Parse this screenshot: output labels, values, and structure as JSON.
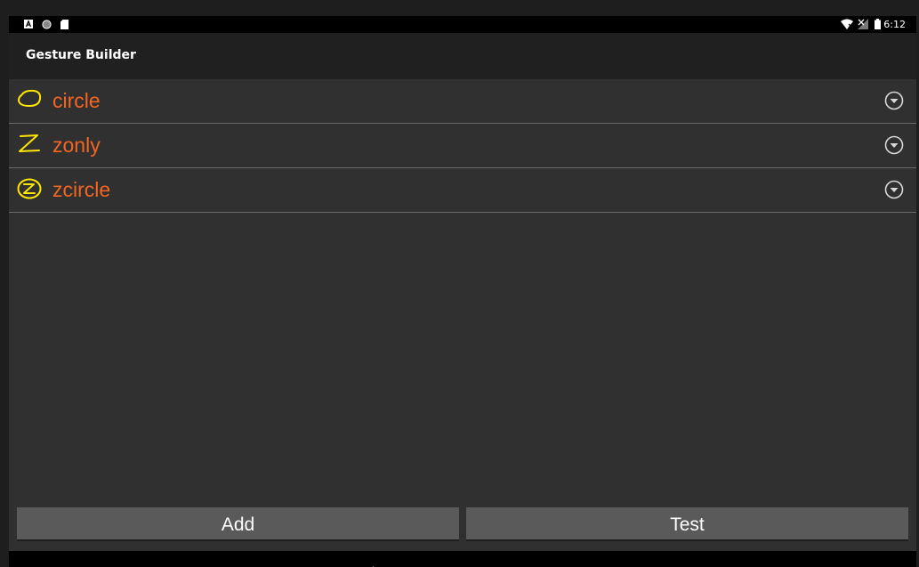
{
  "status_bar": {
    "time": "6:12",
    "left_icons": [
      "a-notification-icon",
      "circle-notification-icon",
      "sd-card-icon"
    ],
    "right_icons": [
      "wifi-icon",
      "no-signal-icon",
      "battery-icon"
    ]
  },
  "action_bar": {
    "title": "Gesture Builder"
  },
  "gestures": [
    {
      "label": "circle",
      "icon": "circle-gesture-icon"
    },
    {
      "label": "zonly",
      "icon": "z-gesture-icon"
    },
    {
      "label": "zcircle",
      "icon": "z-in-circle-gesture-icon"
    }
  ],
  "buttons": {
    "add_label": "Add",
    "test_label": "Test"
  },
  "colors": {
    "label_orange": "#f26522",
    "gesture_yellow": "#ffe600",
    "list_background": "#303030",
    "button_gray": "#5a5a5a"
  }
}
